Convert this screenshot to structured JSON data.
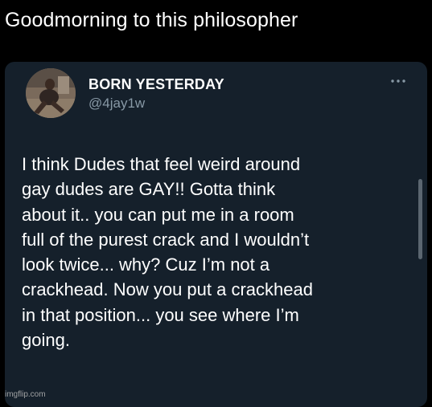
{
  "caption": "Goodmorning to this philosopher",
  "tweet": {
    "display_name": "BORN YESTERDAY",
    "handle": "@4jay1w",
    "more_icon": "ellipsis-icon",
    "text_lines": [
      "I think Dudes that feel weird around",
      "gay dudes are GAY!! Gotta think",
      "about it.. you can put me  in a room",
      "full of the purest crack and I wouldn’t",
      "look twice... why? Cuz I’m not a",
      "crackhead. Now you put a crackhead",
      "in that position... you see where I’m",
      "going."
    ]
  },
  "watermark": "imgflip.com",
  "colors": {
    "page_background": "#000000",
    "card_background": "#15202b",
    "primary_text": "#ffffff",
    "secondary_text": "#8899a6"
  }
}
